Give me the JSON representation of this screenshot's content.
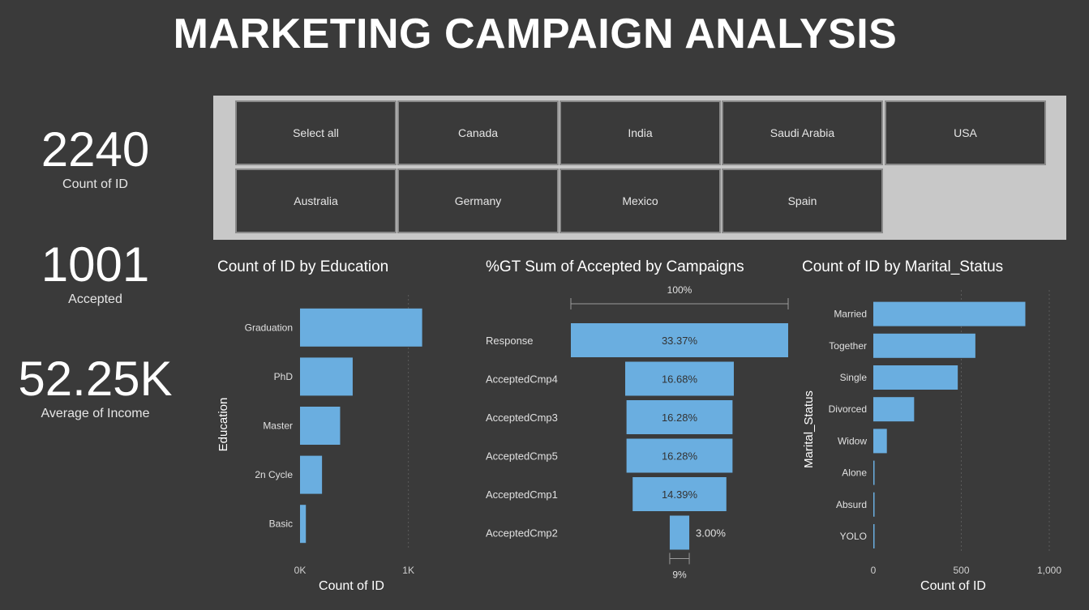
{
  "title": "MARKETING CAMPAIGN ANALYSIS",
  "kpis": [
    {
      "value": "2240",
      "label": "Count of ID"
    },
    {
      "value": "1001",
      "label": "Accepted"
    },
    {
      "value": "52.25K",
      "label": "Average of  Income"
    }
  ],
  "slicer": {
    "items": [
      "Select all",
      "Canada",
      "India",
      "Saudi Arabia",
      "USA",
      "Australia",
      "Germany",
      "Mexico",
      "Spain"
    ]
  },
  "colors": {
    "bar": "#6aaee0",
    "background": "#3a3a3a",
    "slicer_bg": "#c8c8c8"
  },
  "chart_data": [
    {
      "type": "bar",
      "orientation": "horizontal",
      "title": "Count of ID by Education",
      "xlabel": "Count of ID",
      "ylabel": "Education",
      "categories": [
        "Graduation",
        "PhD",
        "Master",
        "2n Cycle",
        "Basic"
      ],
      "values": [
        1127,
        486,
        370,
        203,
        54
      ],
      "xlim": [
        0,
        1100
      ],
      "xticks": [
        {
          "v": 0,
          "label": "0K"
        },
        {
          "v": 1000,
          "label": "1K"
        }
      ],
      "grid": true
    },
    {
      "type": "bar",
      "orientation": "funnel",
      "title": "%GT Sum of Accepted by Campaigns",
      "categories": [
        "Response",
        "AcceptedCmp4",
        "AcceptedCmp3",
        "AcceptedCmp5",
        "AcceptedCmp1",
        "AcceptedCmp2"
      ],
      "values": [
        33.37,
        16.68,
        16.28,
        16.28,
        14.39,
        3.0
      ],
      "value_labels": [
        "33.37%",
        "16.68%",
        "16.28%",
        "16.28%",
        "14.39%",
        "3.00%"
      ],
      "top_marker": "100%",
      "bottom_marker": "9%"
    },
    {
      "type": "bar",
      "orientation": "horizontal",
      "title": "Count of ID by Marital_Status",
      "xlabel": "Count of ID",
      "ylabel": "Marital_Status",
      "categories": [
        "Married",
        "Together",
        "Single",
        "Divorced",
        "Widow",
        "Alone",
        "Absurd",
        "YOLO"
      ],
      "values": [
        864,
        580,
        480,
        232,
        77,
        3,
        2,
        2
      ],
      "xlim": [
        0,
        1000
      ],
      "xticks": [
        {
          "v": 0,
          "label": "0"
        },
        {
          "v": 500,
          "label": "500"
        },
        {
          "v": 1000,
          "label": "1,000"
        }
      ],
      "grid": true
    }
  ]
}
